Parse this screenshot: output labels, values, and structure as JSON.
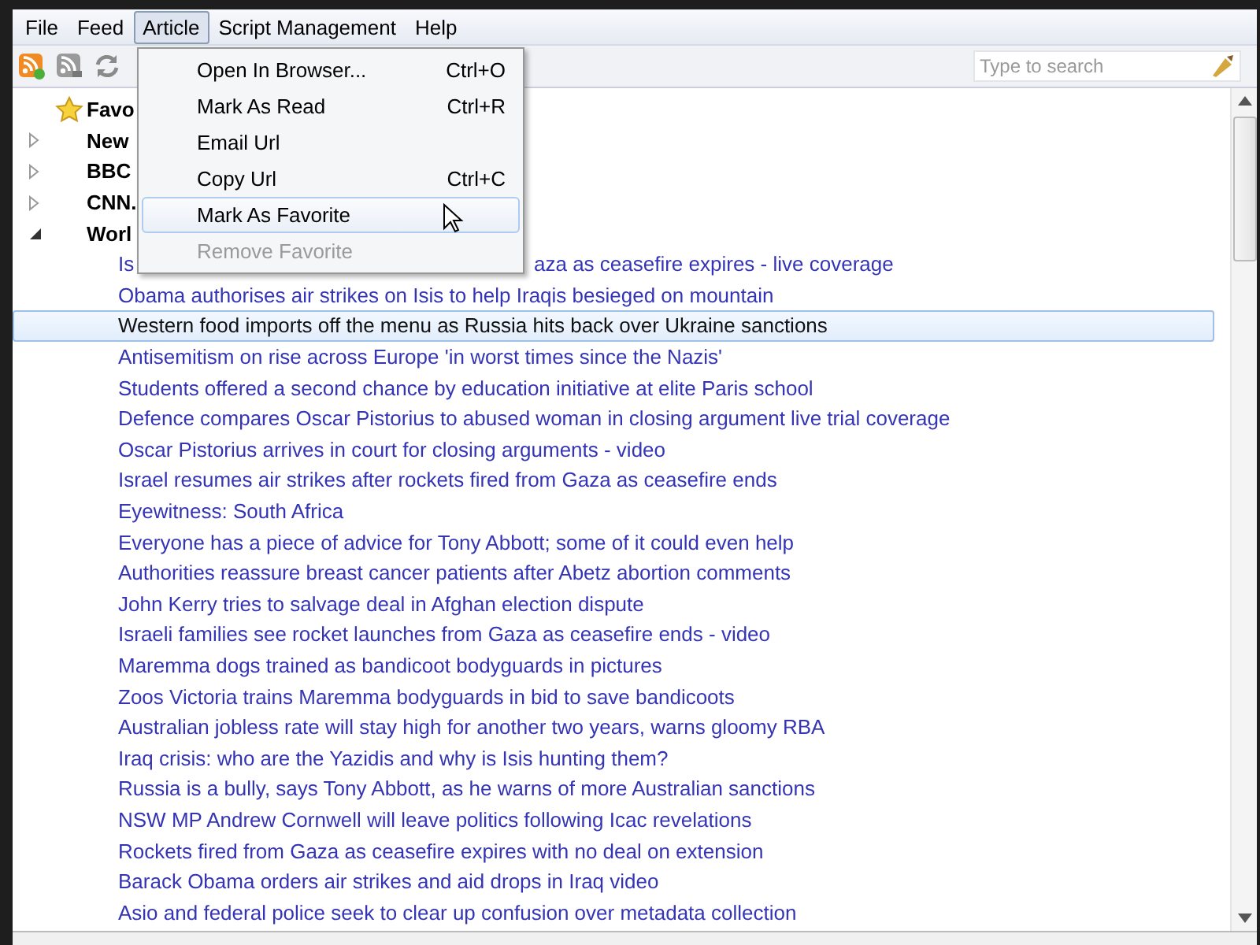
{
  "menubar": [
    {
      "label": "File",
      "selected": false
    },
    {
      "label": "Feed",
      "selected": false
    },
    {
      "label": "Article",
      "selected": true
    },
    {
      "label": "Script Management",
      "selected": false
    },
    {
      "label": "Help",
      "selected": false
    }
  ],
  "menu": {
    "items": [
      {
        "label": "Open In Browser...",
        "shortcut": "Ctrl+O",
        "disabled": false,
        "selected": false
      },
      {
        "label": "Mark As Read",
        "shortcut": "Ctrl+R",
        "disabled": false,
        "selected": false
      },
      {
        "label": "Email Url",
        "disabled": false,
        "selected": false
      },
      {
        "label": "Copy Url",
        "shortcut": "Ctrl+C",
        "disabled": false,
        "selected": false
      },
      {
        "label": "Mark As Favorite",
        "disabled": false,
        "selected": true
      },
      {
        "label": "Remove Favorite",
        "disabled": true,
        "selected": false
      }
    ]
  },
  "search": {
    "placeholder": "Type to search"
  },
  "tree": [
    {
      "kind": "favorites",
      "label": "Favo"
    },
    {
      "kind": "feed",
      "label": "New",
      "expanded": false
    },
    {
      "kind": "feed",
      "label": "BBC",
      "expanded": false
    },
    {
      "kind": "feed",
      "label": "CNN.",
      "expanded": false
    },
    {
      "kind": "feed",
      "label": "Worl",
      "expanded": true,
      "children": [
        {
          "title": "Is",
          "title_after_menu": "aza as ceasefire expires - live coverage",
          "selected": false
        },
        {
          "title": "Obama authorises air strikes on Isis to help Iraqis besieged on mountain",
          "selected": false
        },
        {
          "title": "Western food imports off the menu as Russia hits back over Ukraine sanctions",
          "selected": true
        },
        {
          "title": "Antisemitism on rise across Europe 'in worst times since the Nazis'",
          "selected": false
        },
        {
          "title": "Students offered a second chance by education initiative at elite Paris school",
          "selected": false
        },
        {
          "title": "Defence compares Oscar Pistorius to abused woman in closing argument  live trial coverage",
          "selected": false
        },
        {
          "title": "Oscar Pistorius arrives in court for closing arguments - video",
          "selected": false
        },
        {
          "title": "Israel resumes air strikes after rockets fired from Gaza as ceasefire ends",
          "selected": false
        },
        {
          "title": "Eyewitness: South Africa",
          "selected": false
        },
        {
          "title": "Everyone has a piece of advice for Tony Abbott; some of it could even help",
          "selected": false
        },
        {
          "title": "Authorities reassure breast cancer patients after Abetz abortion comments",
          "selected": false
        },
        {
          "title": "John Kerry tries to salvage deal in Afghan election dispute",
          "selected": false
        },
        {
          "title": "Israeli families see rocket launches from Gaza as ceasefire ends - video",
          "selected": false
        },
        {
          "title": "Maremma dogs trained as bandicoot bodyguards  in pictures",
          "selected": false
        },
        {
          "title": "Zoos Victoria trains Maremma bodyguards in bid to save bandicoots",
          "selected": false
        },
        {
          "title": "Australian jobless rate will stay high for another two years, warns gloomy RBA",
          "selected": false
        },
        {
          "title": "Iraq crisis: who are the Yazidis and why is Isis hunting them?",
          "selected": false
        },
        {
          "title": "Russia is a bully, says Tony Abbott, as he warns of more Australian sanctions",
          "selected": false
        },
        {
          "title": "NSW MP Andrew Cornwell will leave politics following Icac revelations",
          "selected": false
        },
        {
          "title": "Rockets fired from Gaza as ceasefire expires with no deal on extension",
          "selected": false
        },
        {
          "title": "Barack Obama orders air strikes and aid drops in Iraq  video",
          "selected": false
        },
        {
          "title": "Asio and federal police seek to clear up confusion over metadata collection",
          "selected": false
        }
      ]
    }
  ]
}
